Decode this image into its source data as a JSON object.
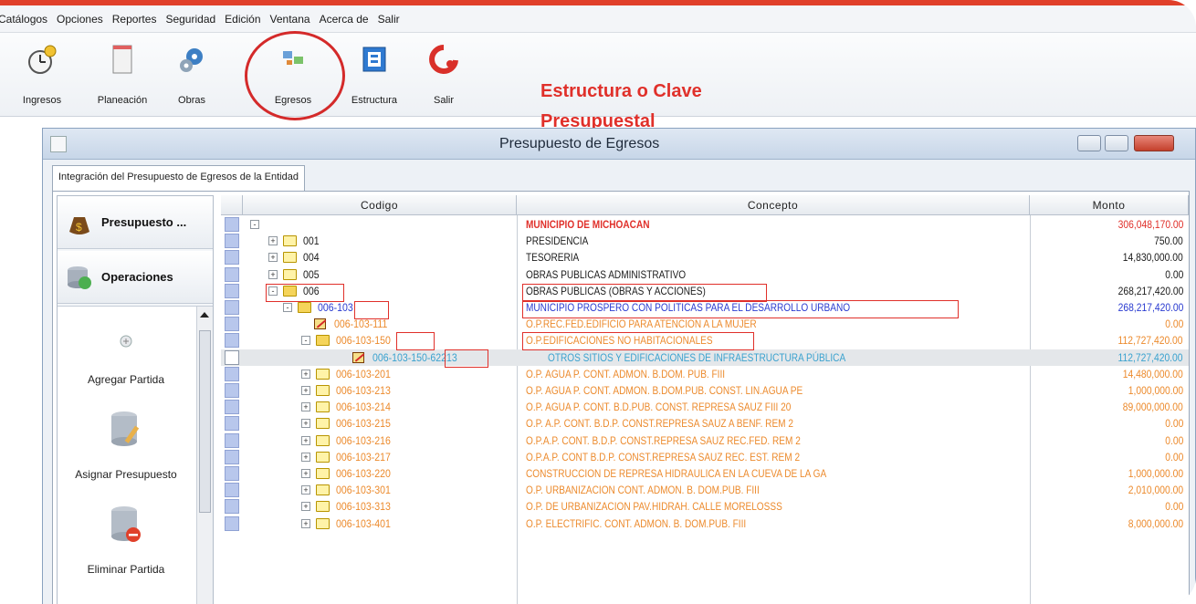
{
  "menubar": [
    "Catálogos",
    "Opciones",
    "Reportes",
    "Seguridad",
    "Edición",
    "Ventana",
    "Acerca de",
    "Salir"
  ],
  "toolbar": {
    "ingresos": "Ingresos",
    "planeacion": "Planeación",
    "obras": "Obras",
    "egresos": "Egresos",
    "estructura": "Estructura",
    "salir": "Salir"
  },
  "headline": {
    "line1": "Estructura o Clave",
    "line2": "Presupuestal"
  },
  "window": {
    "title": "Presupuesto de Egresos",
    "tab": "Integración del Presupuesto de Egresos de la Entidad"
  },
  "nav": {
    "presupuesto": "Presupuesto ...",
    "operaciones": "Operaciones"
  },
  "actions": {
    "agregar": "Agregar Partida",
    "asignar": "Asignar Presupuesto",
    "eliminar": "Eliminar Partida"
  },
  "grid": {
    "headers": {
      "codigo": "Codigo",
      "concepto": "Concepto",
      "monto": "Monto"
    },
    "rows": [
      {
        "code": "",
        "concept": "MUNICIPIO DE MICHOACAN",
        "monto": "306,048,170.00"
      },
      {
        "code": "001",
        "concept": "PRESIDENCIA",
        "monto": "750.00"
      },
      {
        "code": "004",
        "concept": "TESORERIA",
        "monto": "14,830,000.00"
      },
      {
        "code": "005",
        "concept": "OBRAS PUBLICAS ADMINISTRATIVO",
        "monto": "0.00"
      },
      {
        "code": "006",
        "concept": "OBRAS PUBLICAS (OBRAS Y ACCIONES)",
        "monto": "268,217,420.00"
      },
      {
        "code": "006-103",
        "concept": "MUNICIPIO PROSPERO CON POLITICAS PARA EL DESARROLLO URBANO",
        "monto": "268,217,420.00"
      },
      {
        "code": "006-103-111",
        "concept": "O.P.REC.FED.EDIFICIO PARA ATENCION A LA MUJER",
        "monto": "0.00"
      },
      {
        "code": "006-103-150",
        "concept": "O.P.EDIFICACIONES NO HABITACIONALES",
        "monto": "112,727,420.00"
      },
      {
        "code": "006-103-150-62213",
        "concept": "OTROS SITIOS Y EDIFICACIONES DE INFRAESTRUCTURA PÚBLICA",
        "monto": "112,727,420.00"
      },
      {
        "code": "006-103-201",
        "concept": "O.P. AGUA P. CONT. ADMON. B.DOM. PUB. FIII",
        "monto": "14,480,000.00"
      },
      {
        "code": "006-103-213",
        "concept": "O.P. AGUA P. CONT. ADMON. B.DOM.PUB. CONST. LIN.AGUA PE",
        "monto": "1,000,000.00"
      },
      {
        "code": "006-103-214",
        "concept": "O.P. AGUA P. CONT. B.D.PUB. CONST. REPRESA SAUZ FIII 20",
        "monto": "89,000,000.00"
      },
      {
        "code": "006-103-215",
        "concept": "O.P. A.P. CONT. B.D.P. CONST.REPRESA SAUZ A BENF. REM 2",
        "monto": "0.00"
      },
      {
        "code": "006-103-216",
        "concept": "O.P.A.P. CONT. B.D.P. CONST.REPRESA SAUZ REC.FED. REM 2",
        "monto": "0.00"
      },
      {
        "code": "006-103-217",
        "concept": "O.P.A.P. CONT B.D.P. CONST.REPRESA SAUZ REC. EST. REM 2",
        "monto": "0.00"
      },
      {
        "code": "006-103-220",
        "concept": "CONSTRUCCION DE REPRESA HIDRAULICA EN LA CUEVA DE LA GA",
        "monto": "1,000,000.00"
      },
      {
        "code": "006-103-301",
        "concept": "O.P. URBANIZACION CONT. ADMON. B. DOM.PUB. FIII",
        "monto": "2,010,000.00"
      },
      {
        "code": "006-103-313",
        "concept": "O.P. DE URBANIZACION PAV.HIDRAH. CALLE MORELOSSS",
        "monto": "0.00"
      },
      {
        "code": "006-103-401",
        "concept": "O.P. ELECTRIFIC. CONT. ADMON. B. DOM.PUB. FIII",
        "monto": "8,000,000.00"
      }
    ]
  }
}
